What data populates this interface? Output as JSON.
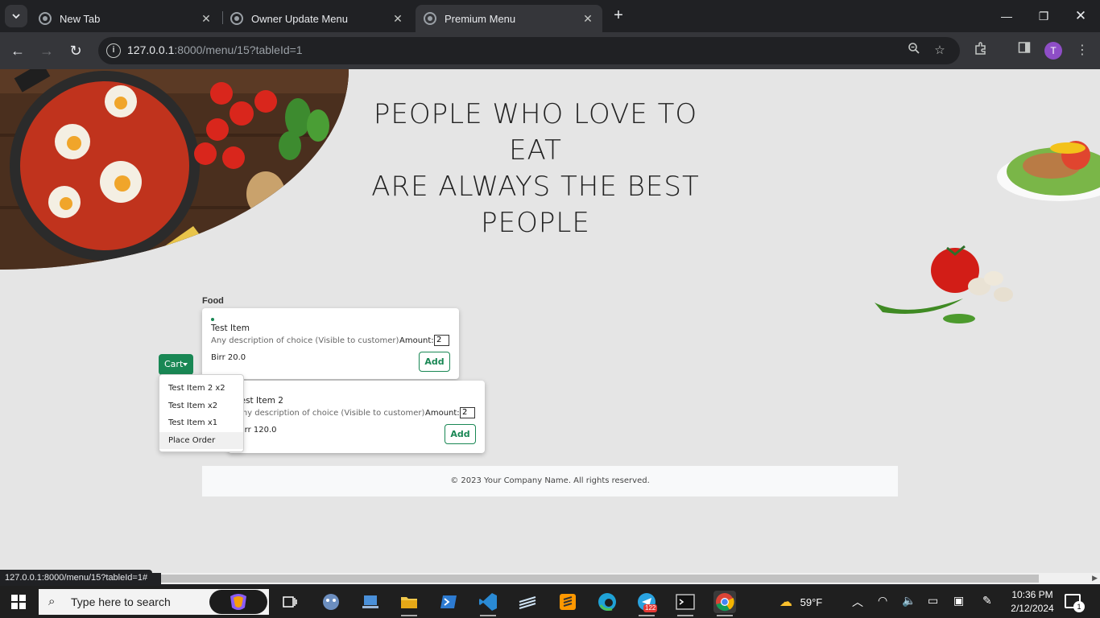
{
  "browser": {
    "tabs": [
      {
        "title": "New Tab"
      },
      {
        "title": "Owner Update Menu"
      },
      {
        "title": "Premium Menu"
      }
    ],
    "url_host": "127.0.0.1",
    "url_path": ":8000/menu/15?tableId=1",
    "profile_initial": "T",
    "status_url": "127.0.0.1:8000/menu/15?tableId=1#"
  },
  "hero": {
    "headline_lines": [
      "PEOPLE WHO LOVE TO",
      "EAT",
      "ARE ALWAYS THE BEST",
      "PEOPLE"
    ]
  },
  "menu": {
    "section_title": "Food",
    "items": [
      {
        "name": "Test Item",
        "description": "Any description of choice (Visible to customer)",
        "amount_label": "Amount:",
        "amount_value": "2",
        "price": "Birr 20.0",
        "add_label": "Add"
      },
      {
        "name": "Test Item 2",
        "description": "Any description of choice (Visible to customer)",
        "amount_label": "Amount:",
        "amount_value": "2",
        "price": "Birr 120.0",
        "add_label": "Add"
      }
    ]
  },
  "cart": {
    "button_label": "Cart",
    "entries": [
      "Test Item 2 x2",
      "Test Item x2",
      "Test Item x1"
    ],
    "place_order_label": "Place Order"
  },
  "footer": {
    "text": "© 2023 Your Company Name. All rights reserved."
  },
  "taskbar": {
    "search_placeholder": "Type here to search",
    "weather_temp": "59°F",
    "time": "10:36 PM",
    "date": "2/12/2024",
    "telegram_badge": "122",
    "notification_count": "1"
  },
  "colors": {
    "accent_green": "#198754",
    "page_bg": "#e5e5e5",
    "chrome_dark": "#202124",
    "chrome_toolbar": "#35363a"
  }
}
